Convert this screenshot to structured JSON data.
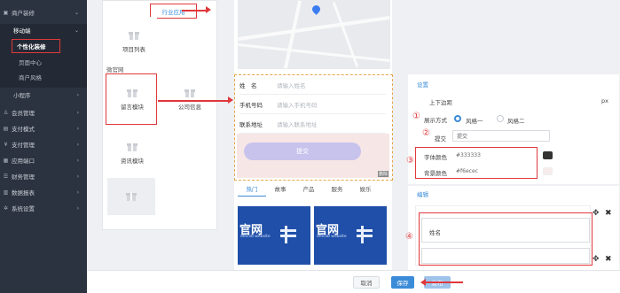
{
  "sidebar": {
    "items": [
      {
        "label": "商户装修",
        "icon": "store-icon",
        "expanded": true
      },
      {
        "label": "移动端",
        "expanded": true
      },
      {
        "label": "个性化装修",
        "current": true
      },
      {
        "label": "页面中心"
      },
      {
        "label": "商户风格"
      },
      {
        "label": "小程序"
      },
      {
        "label": "会员管理",
        "icon": "member-icon"
      },
      {
        "label": "支付模式",
        "icon": "payment-mode-icon"
      },
      {
        "label": "支付管理",
        "icon": "payment-icon"
      },
      {
        "label": "应用端口",
        "icon": "app-icon"
      },
      {
        "label": "财务管理",
        "icon": "finance-icon"
      },
      {
        "label": "数据报表",
        "icon": "report-icon"
      },
      {
        "label": "系统设置",
        "icon": "settings-icon"
      }
    ]
  },
  "components": {
    "tab_label": "行业应用",
    "item_project_list": "项目列表",
    "section_title": "微官网",
    "item_message": "留言模块",
    "item_company": "公司信息",
    "item_news": "资讯模块"
  },
  "preview": {
    "form": {
      "rows": [
        {
          "label": "姓　名",
          "placeholder": "请输入姓名"
        },
        {
          "label": "手机号码",
          "placeholder": "请输入手机号码"
        },
        {
          "label": "联系地址",
          "placeholder": "请输入联系地址"
        }
      ],
      "submit": "提交",
      "delete_tag": "删除"
    },
    "news_tabs": [
      "热门",
      "故事",
      "产品",
      "服务",
      "娱乐"
    ],
    "thumb_brand": "官网",
    "thumb_sub": "official website"
  },
  "settings": {
    "title": "设置",
    "margin_label": "上下边距",
    "margin_unit": "px",
    "display_label": "展示方式",
    "style1": "风格一",
    "style2": "风格二",
    "submit_label": "提交",
    "submit_value": "提交",
    "font_color_label": "字体颜色",
    "font_color_value": "#333333",
    "bg_color_label": "背景颜色",
    "bg_color_value": "#f6ecec",
    "colors": {
      "font": "#333333",
      "bg": "#f6ecec"
    },
    "marks": [
      "①",
      "②",
      "③",
      "④"
    ]
  },
  "edit": {
    "title": "编辑",
    "field1_value": "姓名"
  },
  "footer": {
    "cancel": "取消",
    "save": "保存",
    "publish": "发布"
  }
}
